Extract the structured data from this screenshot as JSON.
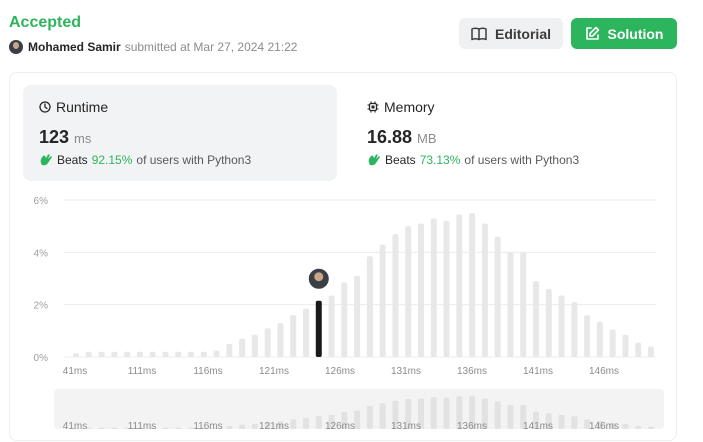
{
  "header": {
    "status": "Accepted",
    "username": "Mohamed Samir",
    "submitted_text": "submitted at Mar 27, 2024 21:22",
    "editorial_label": "Editorial",
    "solution_label": "Solution"
  },
  "runtime": {
    "title": "Runtime",
    "value": "123",
    "unit": "ms",
    "beats_label": "Beats",
    "beats_pct": "92.15%",
    "beats_suffix": "of users with Python3"
  },
  "memory": {
    "title": "Memory",
    "value": "16.88",
    "unit": "MB",
    "beats_label": "Beats",
    "beats_pct": "73.13%",
    "beats_suffix": "of users with Python3"
  },
  "colors": {
    "accent_green": "#2db55d",
    "bar_gray": "#e8e8e8",
    "bar_user": "#1a1a1a"
  },
  "chart_data": {
    "type": "bar",
    "y_ticks": [
      "6%",
      "4%",
      "2%",
      "0%"
    ],
    "ylim": [
      0,
      6
    ],
    "x_tick_labels": [
      "41ms",
      "111ms",
      "116ms",
      "121ms",
      "126ms",
      "131ms",
      "136ms",
      "141ms",
      "146ms"
    ],
    "values": [
      0.15,
      0.2,
      0.2,
      0.2,
      0.2,
      0.2,
      0.2,
      0.2,
      0.2,
      0.2,
      0.2,
      0.25,
      0.5,
      0.7,
      0.85,
      1.1,
      1.3,
      1.6,
      1.85,
      2.15,
      2.35,
      2.85,
      3.1,
      3.85,
      4.3,
      4.7,
      5.0,
      5.1,
      5.3,
      5.2,
      5.45,
      5.5,
      5.1,
      4.6,
      4.0,
      4.0,
      2.9,
      2.6,
      2.35,
      2.1,
      1.6,
      1.35,
      1.05,
      0.85,
      0.55,
      0.4
    ],
    "user_index": 19,
    "grid": true
  }
}
